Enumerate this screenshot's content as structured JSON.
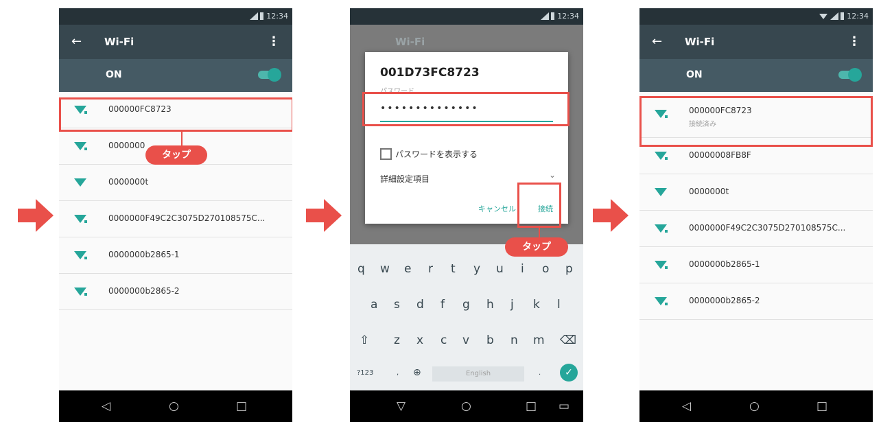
{
  "status": {
    "time": "12:34"
  },
  "common": {
    "back_icon": "arrow-left-icon",
    "wifi_title": "Wi-Fi",
    "menu_icon": "overflow-menu-icon",
    "on_label": "ON",
    "tap_label": "タップ",
    "nav": {
      "back": "◁",
      "home": "○",
      "recents": "□"
    }
  },
  "left": {
    "networks": [
      {
        "ssid": "000000FC8723"
      },
      {
        "ssid": "0000000"
      },
      {
        "ssid": "0000000t"
      },
      {
        "ssid": "0000000F49C2C3075D270108575C..."
      },
      {
        "ssid": "0000000b2865-1"
      },
      {
        "ssid": "0000000b2865-2"
      }
    ]
  },
  "middle": {
    "bg_title": "Wi-Fi",
    "dialog": {
      "ssid": "001D73FC8723",
      "password_label": "パスワード",
      "password_value": "••••••••••••••",
      "show_password": "パスワードを表示する",
      "advanced": "詳細設定項目",
      "cancel": "キャンセル",
      "connect": "接続"
    },
    "keyboard": {
      "row1": [
        "q",
        "w",
        "e",
        "r",
        "t",
        "y",
        "u",
        "i",
        "o",
        "p"
      ],
      "row2": [
        "a",
        "s",
        "d",
        "f",
        "g",
        "h",
        "j",
        "k",
        "l"
      ],
      "row3": [
        "z",
        "x",
        "c",
        "v",
        "b",
        "n",
        "m"
      ],
      "symbols": "?123",
      "comma": ",",
      "period": ".",
      "space": "English"
    },
    "nav": {
      "back": "▽",
      "home": "○",
      "recents": "□"
    }
  },
  "right": {
    "networks": [
      {
        "ssid": "000000FC8723",
        "status": "接続済み"
      },
      {
        "ssid": "00000008FB8F"
      },
      {
        "ssid": "0000000t"
      },
      {
        "ssid": "0000000F49C2C3075D270108575C..."
      },
      {
        "ssid": "0000000b2865-1"
      },
      {
        "ssid": "0000000b2865-2"
      }
    ]
  },
  "colors": {
    "accent": "#26a69a",
    "highlight": "#e9504a",
    "appbar": "#37474f",
    "statusbar": "#263238"
  }
}
